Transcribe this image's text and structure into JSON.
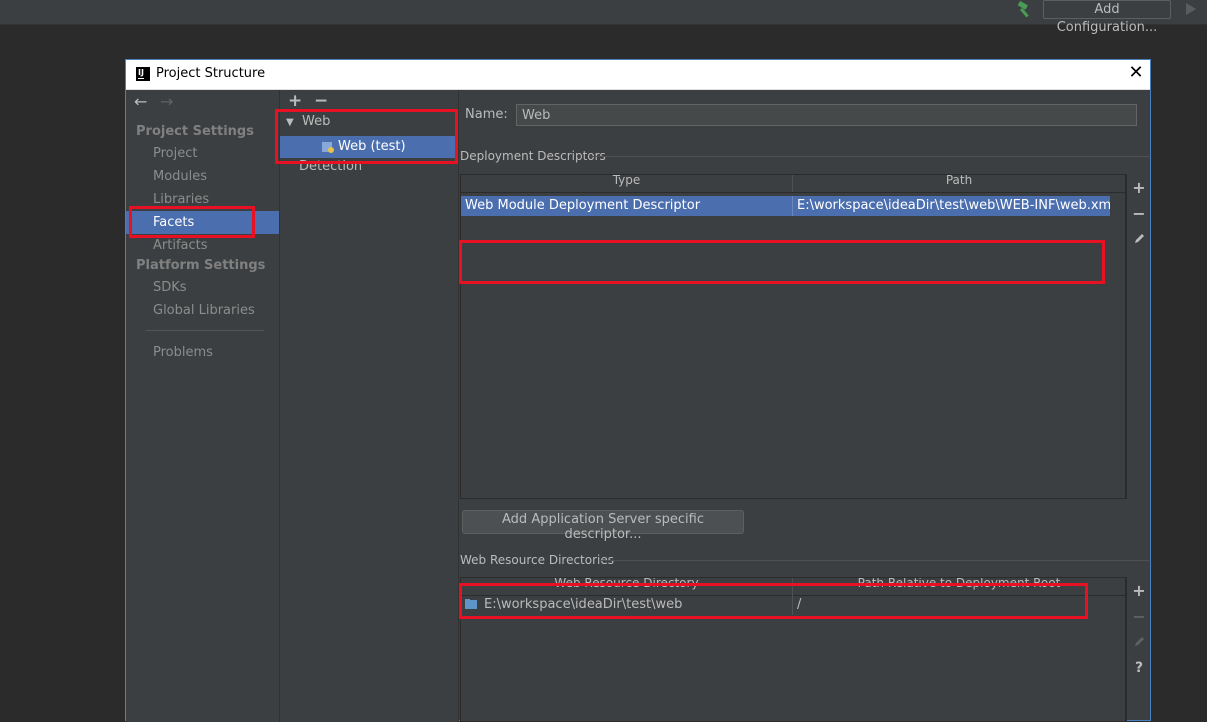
{
  "toolbar": {
    "build_icon": "hammer-icon",
    "add_configuration_label": "Add Configuration...",
    "run_icon": "play-icon"
  },
  "dialog": {
    "app_icon": "IJ",
    "title": "Project Structure",
    "close_symbol": "✕"
  },
  "sidebar": {
    "back_symbol": "←",
    "forward_symbol": "→",
    "project_settings_header": "Project Settings",
    "project_settings_items": [
      "Project",
      "Modules",
      "Libraries",
      "Facets",
      "Artifacts"
    ],
    "platform_settings_header": "Platform Settings",
    "platform_settings_items": [
      "SDKs",
      "Global Libraries"
    ],
    "problems_label": "Problems",
    "selected_item": "Facets"
  },
  "facet_tree": {
    "add_symbol": "+",
    "remove_symbol": "−",
    "root_label": "Web",
    "child_label": "Web (test)",
    "detection_label": "Detection"
  },
  "main": {
    "name_label": "Name:",
    "name_value": "Web",
    "deployment_descriptors_title": "Deployment Descriptors",
    "dd_columns": [
      "Type",
      "Path"
    ],
    "dd_rows": [
      {
        "type": "Web Module Deployment Descriptor",
        "path": "E:\\workspace\\ideaDir\\test\\web\\WEB-INF\\web.xml"
      }
    ],
    "add_server_descriptor_label": "Add Application Server specific descriptor...",
    "web_resource_directories_title": "Web Resource Directories",
    "wr_columns": [
      "Web Resource Directory",
      "Path Relative to Deployment Root"
    ],
    "wr_rows": [
      {
        "directory": "E:\\workspace\\ideaDir\\test\\web",
        "relative_path": "/"
      }
    ],
    "tool_add": "+",
    "tool_remove": "−",
    "tool_help": "?"
  }
}
